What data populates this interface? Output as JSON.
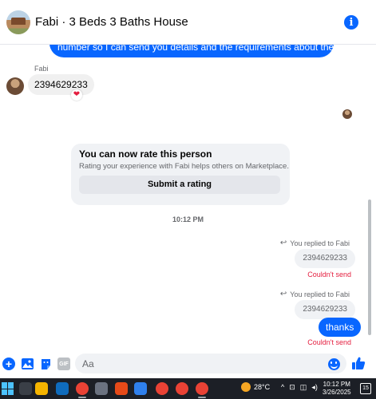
{
  "header": {
    "title": "Fabi · 3 Beds 3 Baths House",
    "info_icon": "info-icon"
  },
  "messages": {
    "outgoing_partial": "number so I can send you details and the requirements about the house.",
    "sender_name": "Fabi",
    "incoming_text": "2394629233",
    "reaction": "❤"
  },
  "rating_card": {
    "title": "You can now rate this person",
    "subtitle": "Rating your experience with Fabi helps others on Marketplace.",
    "button_label": "Submit a rating"
  },
  "timestamp": "10:12 PM",
  "replies": [
    {
      "replied_label": "You replied to Fabi",
      "quoted": "2394629233",
      "status": "Couldn't send"
    },
    {
      "replied_label": "You replied to Fabi",
      "quoted": "2394629233",
      "reply_text": "thanks",
      "status": "Couldn't send"
    }
  ],
  "composer": {
    "placeholder": "Aa",
    "gif_label": "GIF"
  },
  "taskbar": {
    "temperature": "28°C",
    "time": "10:12 PM",
    "date": "3/26/2025",
    "notification_count": "15"
  },
  "colors": {
    "accent": "#0866ff",
    "error": "#e41e3f",
    "bubble_gray": "#f0f0f0"
  }
}
